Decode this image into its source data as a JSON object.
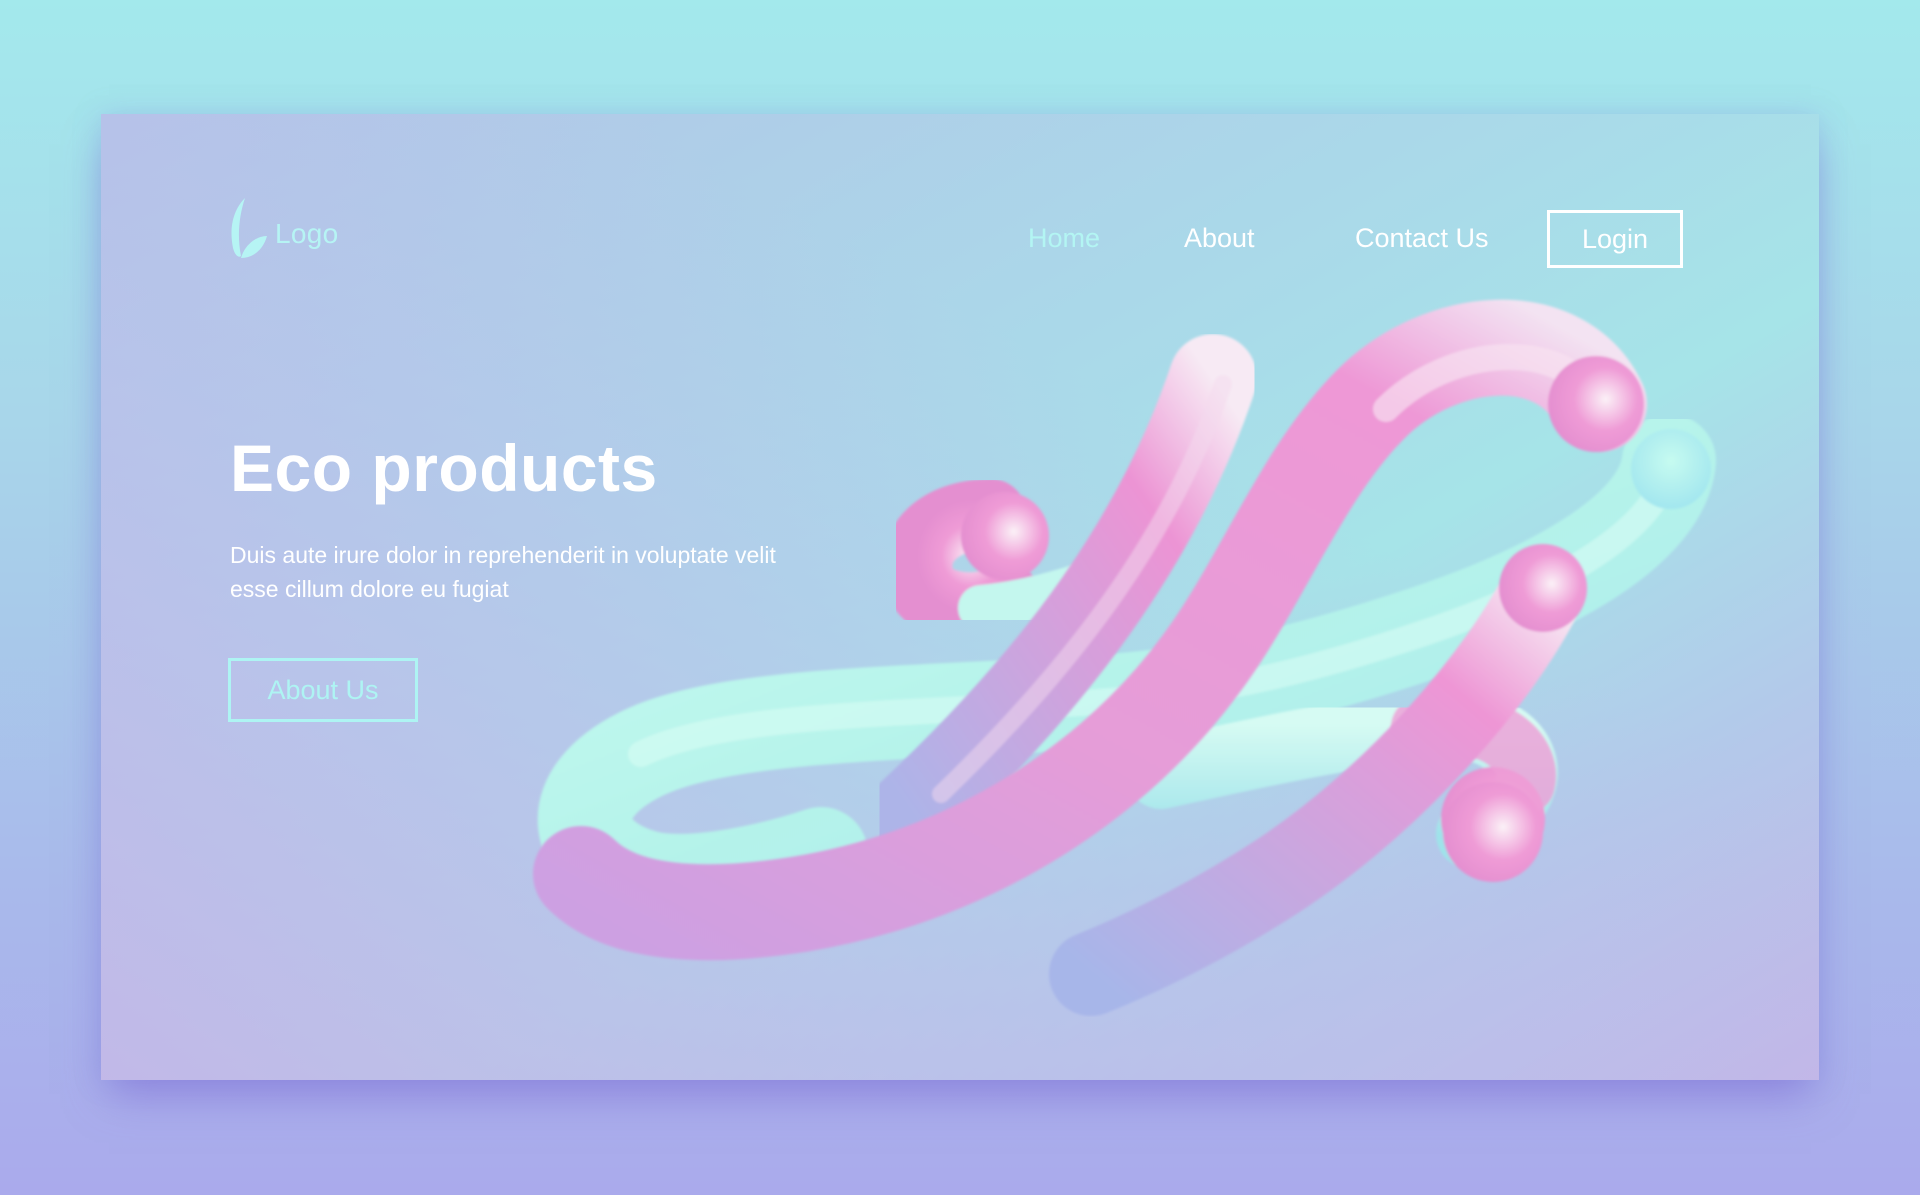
{
  "logo": {
    "text": "Logo",
    "icon": "leaf-icon"
  },
  "nav": {
    "items": [
      {
        "label": "Home",
        "active": true
      },
      {
        "label": "About",
        "active": false
      },
      {
        "label": "Contact Us",
        "active": false
      }
    ],
    "login_label": "Login"
  },
  "hero": {
    "title": "Eco products",
    "description": "Duis aute irure dolor in reprehenderit in voluptate velit esse cillum dolore eu fugiat",
    "cta_label": "About Us"
  },
  "colors": {
    "accent": "#aef4f3",
    "text": "#ffffff",
    "shape_pink": "#ee9ad8",
    "shape_mint": "#b8f6ec",
    "shape_lavender": "#b3aee6"
  }
}
